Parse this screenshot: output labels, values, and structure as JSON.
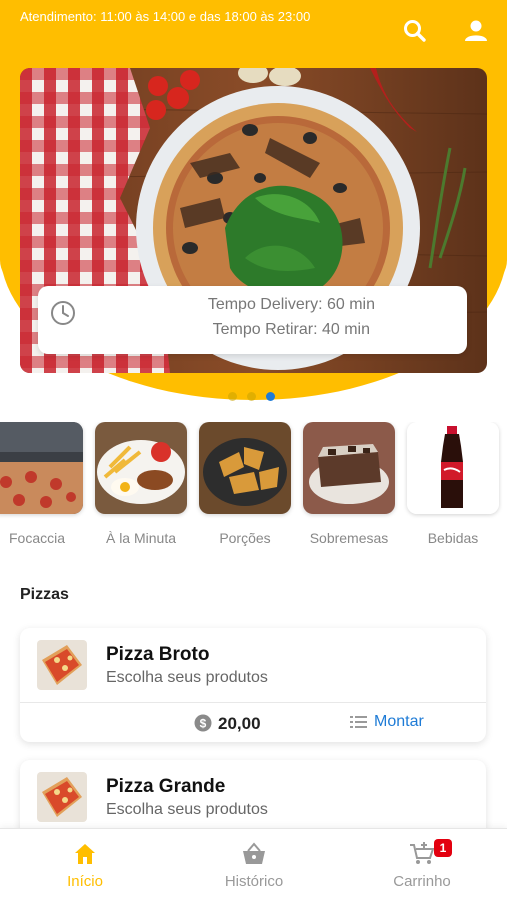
{
  "header": {
    "hours": "Atendimento: 11:00 às 14:00 e das 18:00 às 23:00",
    "search_icon": "search-icon",
    "user_icon": "user-icon",
    "accent_color": "#FFBE00"
  },
  "banner": {
    "delivery_time": "Tempo Delivery: 60 min",
    "pickup_time": "Tempo Retirar: 40 min",
    "clock_icon": "clock-icon",
    "slides": 3,
    "active_slide": 3
  },
  "categories": [
    {
      "label": "Focaccia"
    },
    {
      "label": "À la Minuta"
    },
    {
      "label": "Porções"
    },
    {
      "label": "Sobremesas"
    },
    {
      "label": "Bebidas"
    }
  ],
  "section": {
    "title": "Pizzas"
  },
  "products": [
    {
      "name": "Pizza Broto",
      "desc": "Escolha seus produtos",
      "price": "20,00",
      "action": "Montar"
    },
    {
      "name": "Pizza Grande",
      "desc": "Escolha seus produtos"
    }
  ],
  "nav": {
    "home": "Início",
    "history": "Histórico",
    "cart": "Carrinho",
    "cart_count": "1",
    "link_color": "#1E7BD6"
  }
}
